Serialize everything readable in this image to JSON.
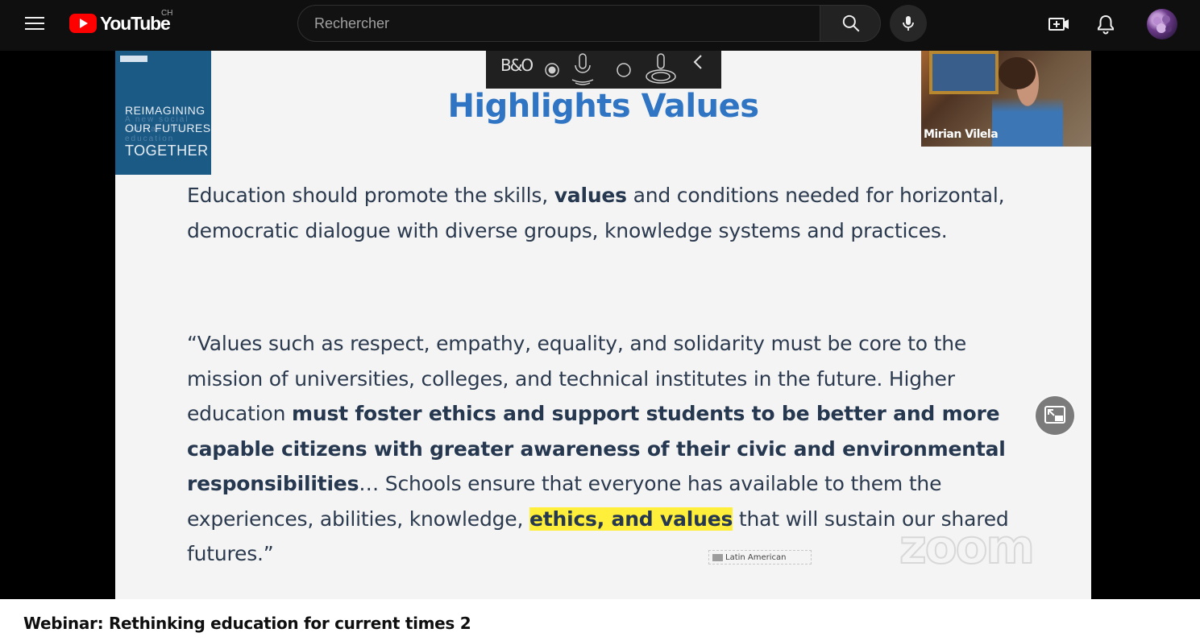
{
  "masthead": {
    "logo_text": "YouTube",
    "region": "CH",
    "search_placeholder": "Rechercher",
    "icons": [
      "menu-icon",
      "search-icon",
      "mic-icon",
      "create-video-icon",
      "bell-icon"
    ]
  },
  "player": {
    "slide": {
      "book": {
        "line1": "REIMAGINING",
        "line2": "OUR FUTURES",
        "line3": "TOGETHER",
        "faint": "A new social contract for education"
      },
      "zoombar_brand": "B&O",
      "title": "Highlights Values",
      "paragraph1": {
        "before": "Education should promote the skills, ",
        "bold": "values",
        "after": " and conditions needed for horizontal, democratic dialogue with diverse groups, knowledge systems and practices."
      },
      "paragraph2": {
        "intro": "“Values such as respect, empathy, equality, and solidarity must be core to the mission of universities, colleges, and technical institutes in the future. Higher education ",
        "bold": "must foster ethics and support students to be better and more capable citizens with greater awareness of their civic and environmental responsibilities",
        "middle": "… Schools ensure that everyone has available to them the experiences, abilities, knowledge, ",
        "highlight": "ethics, and values",
        "end": " that will sustain our shared futures.”"
      },
      "language_tag": "Latin American",
      "watermark": "zoom"
    },
    "webcam_name": "Mirian Vilela",
    "accent": "#2f75c4",
    "highlight_color": "#ffef3a"
  },
  "video": {
    "title": "Webinar: Rethinking education for current times 2"
  }
}
